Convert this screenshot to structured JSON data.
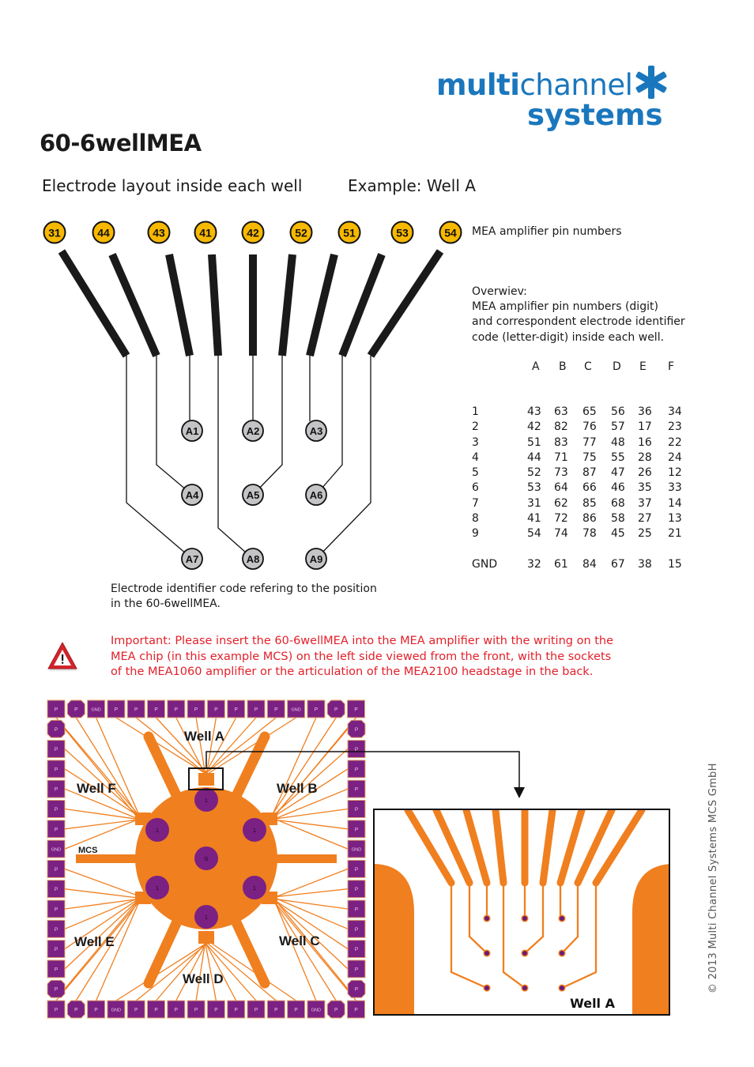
{
  "logo": {
    "brand_bold": "multi",
    "brand_light": "channel",
    "brand_line2": "systems",
    "mark_icon": "asterisk-icon",
    "color": "#1a77bd"
  },
  "title": "60-6wellMEA",
  "subtitles": {
    "left": "Electrode layout inside each well",
    "right": "Example: Well A"
  },
  "layout_diagram": {
    "amplifier_pins": [
      "31",
      "44",
      "43",
      "41",
      "42",
      "52",
      "51",
      "53",
      "54"
    ],
    "amplifier_pins_label": "MEA amplifier pin numbers",
    "pin_color": "#f7b800",
    "electrodes": [
      [
        "A1",
        "A2",
        "A3"
      ],
      [
        "A4",
        "A5",
        "A6"
      ],
      [
        "A7",
        "A8",
        "A9"
      ]
    ],
    "electrode_color": "#c4c4c6",
    "caption_line1": "Electrode identifier code refering to the position",
    "caption_line2": "in the 60-6wellMEA."
  },
  "overview": {
    "heading": "Overwiev:",
    "line1": "MEA amplifier pin numbers (digit)",
    "line2": "and correspondent electrode identifier",
    "line3": "code (letter-digit) inside each well.",
    "columns": [
      "A",
      "B",
      "C",
      "D",
      "E",
      "F"
    ],
    "rows": [
      {
        "label": "1",
        "values": [
          "43",
          "63",
          "65",
          "56",
          "36",
          "34"
        ]
      },
      {
        "label": "2",
        "values": [
          "42",
          "82",
          "76",
          "57",
          "17",
          "23"
        ]
      },
      {
        "label": "3",
        "values": [
          "51",
          "83",
          "77",
          "48",
          "16",
          "22"
        ]
      },
      {
        "label": "4",
        "values": [
          "44",
          "71",
          "75",
          "55",
          "28",
          "24"
        ]
      },
      {
        "label": "5",
        "values": [
          "52",
          "73",
          "87",
          "47",
          "26",
          "12"
        ]
      },
      {
        "label": "6",
        "values": [
          "53",
          "64",
          "66",
          "46",
          "35",
          "33"
        ]
      },
      {
        "label": "7",
        "values": [
          "31",
          "62",
          "85",
          "68",
          "37",
          "14"
        ]
      },
      {
        "label": "8",
        "values": [
          "41",
          "72",
          "86",
          "58",
          "27",
          "13"
        ]
      },
      {
        "label": "9",
        "values": [
          "54",
          "74",
          "78",
          "45",
          "25",
          "21"
        ]
      },
      {
        "label": "GND",
        "values": [
          "32",
          "61",
          "84",
          "67",
          "38",
          "15"
        ]
      }
    ]
  },
  "warning": {
    "icon": "warning-triangle-icon",
    "line1": "Important: Please insert the 60-6wellMEA into the MEA amplifier with the writing on the",
    "line2": "MEA chip (in this example MCS) on the left side viewed from the front, with the sockets",
    "line3": "of the MEA1060 amplifier or the articulation of the MEA2100 headstage in the back.",
    "color": "#e3202a"
  },
  "chip": {
    "wells": {
      "a": "Well A",
      "b": "Well B",
      "c": "Well C",
      "d": "Well D",
      "e": "Well E",
      "f": "Well F"
    },
    "writing": "MCS",
    "pad_label": "P",
    "gnd_label": "GND",
    "well_electrode_label": "1",
    "ground_label": "G",
    "pad_color": "#7b2183",
    "trace_color": "#f07f1f",
    "top_pads": [
      "P",
      "P",
      "GND",
      "P",
      "P",
      "P",
      "P",
      "P",
      "P",
      "P",
      "P",
      "P",
      "GND",
      "P",
      "P",
      "P"
    ],
    "bottom_pads": [
      "P",
      "P",
      "P",
      "GND",
      "P",
      "P",
      "P",
      "P",
      "P",
      "P",
      "P",
      "P",
      "P",
      "GND",
      "P",
      "P"
    ],
    "left_pads": [
      "P",
      "P",
      "P",
      "P",
      "P",
      "P",
      "P",
      "GND",
      "P",
      "P",
      "P",
      "P",
      "P",
      "P",
      "P",
      "P"
    ],
    "right_pads": [
      "P",
      "P",
      "P",
      "P",
      "P",
      "P",
      "P",
      "GND",
      "P",
      "P",
      "P",
      "P",
      "P",
      "P",
      "P",
      "P"
    ]
  },
  "inset": {
    "label": "Well A"
  },
  "copyright": "© 2013 Multi Channel Systems MCS GmbH"
}
